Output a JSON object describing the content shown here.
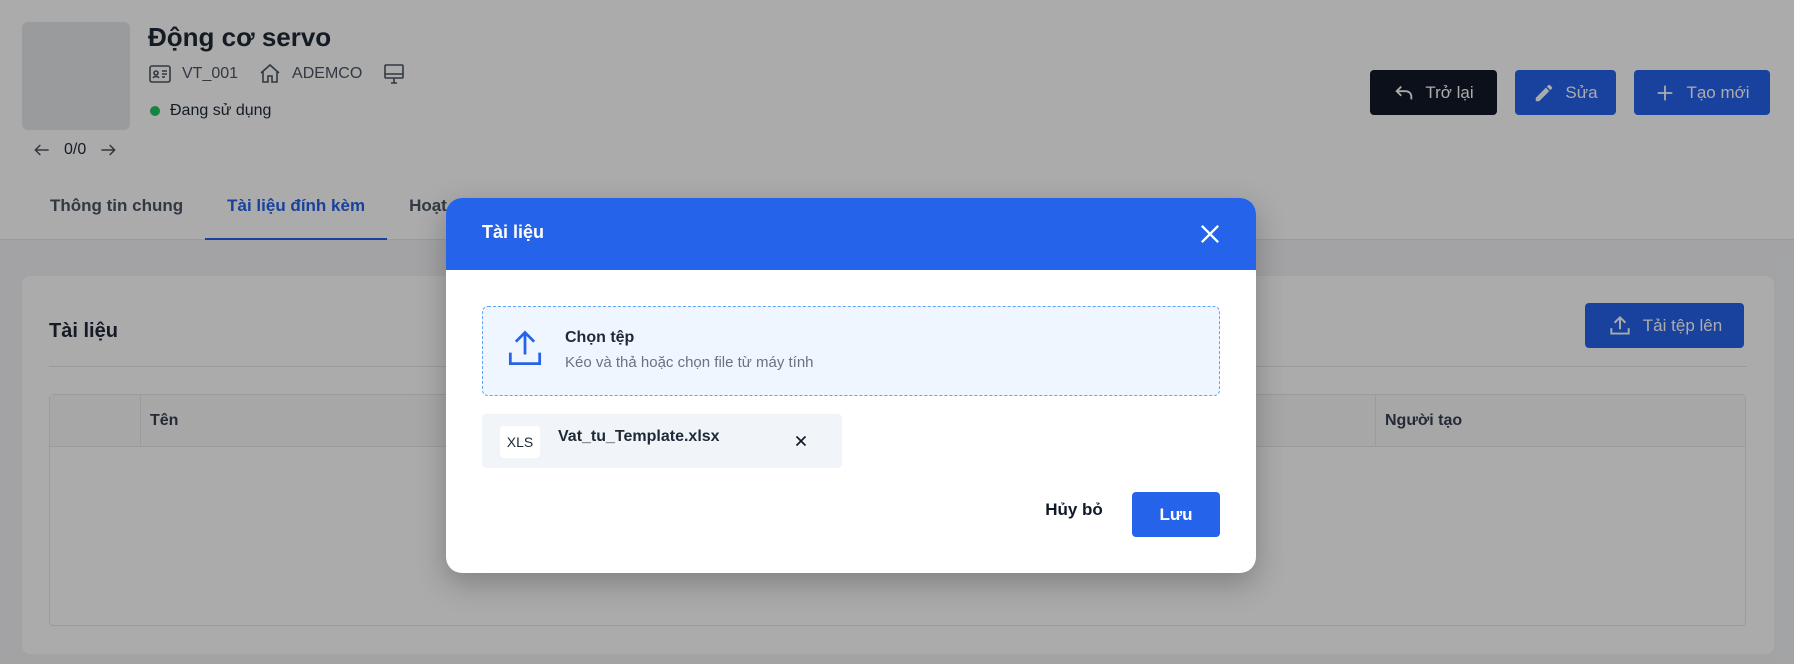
{
  "header": {
    "title": "Động cơ servo",
    "meta": {
      "code": "VT_001",
      "company": "ADEMCO"
    },
    "status": "Đang sử dụng",
    "pager": "0/0",
    "buttons": {
      "back": "Trở lại",
      "edit": "Sửa",
      "new": "Tạo mới"
    }
  },
  "tabs": [
    "Thông tin chung",
    "Tài liệu đính kèm",
    "Hoạt"
  ],
  "card": {
    "title": "Tài liệu",
    "upload_label": "Tải tệp lên",
    "columns": [
      "Tên",
      "Người tạo"
    ]
  },
  "modal": {
    "title": "Tài liệu",
    "drop_title": "Chọn tệp",
    "drop_subtitle": "Kéo và thả hoặc chọn file từ máy tính",
    "file": {
      "badge": "XLS",
      "name": "Vat_tu_Template.xlsx"
    },
    "cancel_label": "Hủy bỏ",
    "save_label": "Lưu"
  },
  "icons": {
    "id-card": "id-card-icon",
    "home": "home-icon",
    "monitor": "monitor-icon",
    "back": "undo-arrow-icon",
    "edit": "pencil-icon",
    "new": "plus-icon",
    "upload": "upload-icon",
    "close": "close-icon"
  },
  "colors": {
    "primary": "#2563eb",
    "dark": "#111827",
    "status_ok": "#22c55e"
  }
}
